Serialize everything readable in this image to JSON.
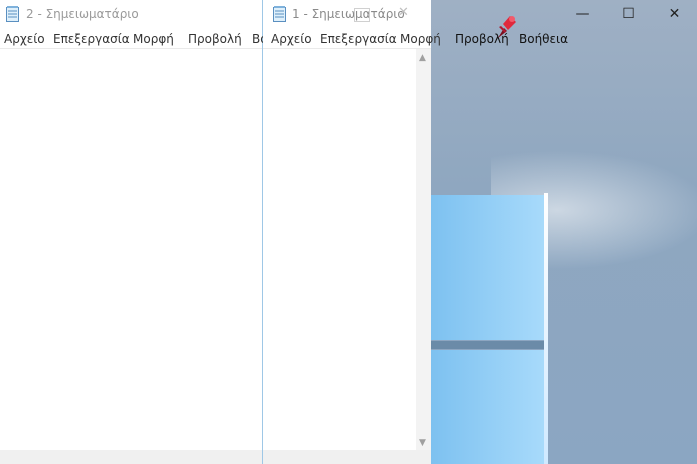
{
  "windows": {
    "notepad2": {
      "title": "2 - Σημειωματάριο",
      "menu": [
        "Αρχείο",
        "Επεξεργασία",
        "Μορφή",
        "Προβολή",
        "Βοή"
      ]
    },
    "notepad1": {
      "title": "1 - Σημειωματάριο",
      "menu": [
        "Αρχείο",
        "Επεξεργασία",
        "Μορφή",
        "Προβολή",
        "Βοήθεια"
      ]
    }
  },
  "controls": {
    "minimize": "—",
    "maximize": "☐",
    "close": "✕"
  },
  "colors": {
    "accent": "#9ec7e6",
    "pin": "#e0283c"
  }
}
